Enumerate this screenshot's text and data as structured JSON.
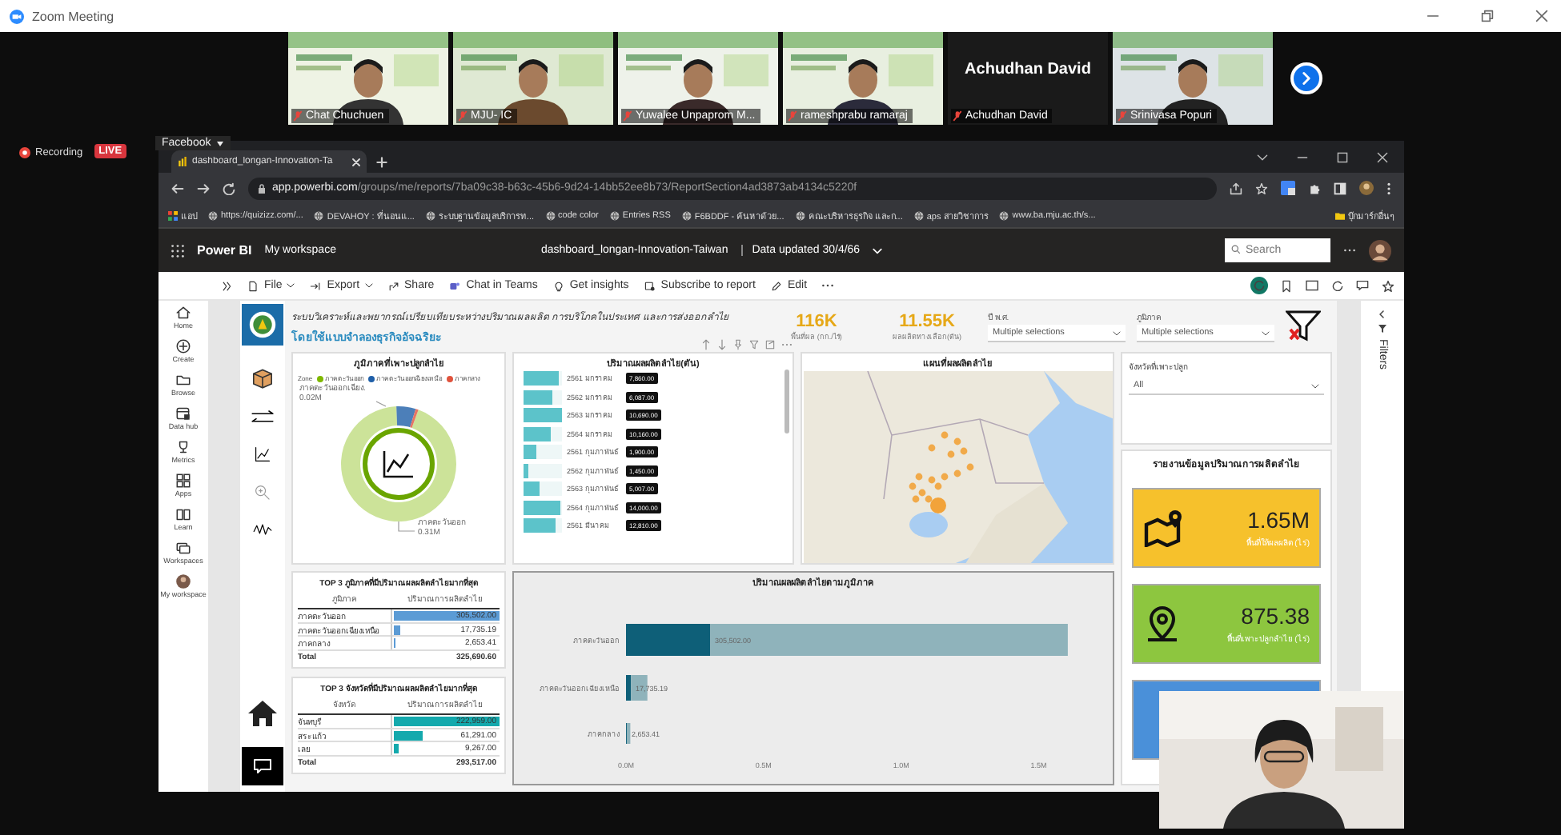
{
  "zoom_window": {
    "title": "Zoom Meeting"
  },
  "participants": [
    {
      "name": "Chat Chuchuen",
      "kind": "video",
      "muted": true
    },
    {
      "name": "MJU- IC",
      "kind": "video",
      "muted": true
    },
    {
      "name": "Yuwalee Unpaprom M...",
      "kind": "video",
      "muted": true
    },
    {
      "name": "rameshprabu ramaraj",
      "kind": "video",
      "muted": true
    },
    {
      "name": "Achudhan David",
      "kind": "name_only",
      "display_name": "Achudhan David",
      "muted": true
    },
    {
      "name": "Srinivasa Popuri",
      "kind": "video",
      "muted": true
    }
  ],
  "recording": {
    "label": "Recording",
    "live_badge": "LIVE"
  },
  "share_menu": {
    "label": "Facebook"
  },
  "browser": {
    "tab_title": "dashboard_longan-Innovation-Ta",
    "url_host": "app.powerbi.com",
    "url_path": "/groups/me/reports/7ba09c38-b63c-45b6-9d24-14bb52ee8b73/ReportSection4ad3873ab4134c5220f",
    "bookmarks": [
      {
        "label": "แอป"
      },
      {
        "label": "https://quizizz.com/..."
      },
      {
        "label": "DEVAHOY : ที่นอนแ..."
      },
      {
        "label": "ระบบฐานข้อมูลบริการท..."
      },
      {
        "label": "code color"
      },
      {
        "label": "Entries RSS"
      },
      {
        "label": "F6BDDF - ค้นหาด้วย..."
      },
      {
        "label": "คณะบริหารธุรกิจ และก..."
      },
      {
        "label": "aps สายวิชาการ"
      },
      {
        "label": "www.ba.mju.ac.th/s..."
      }
    ],
    "other_bookmarks": "บุ๊กมาร์กอื่นๆ"
  },
  "powerbi": {
    "app_name": "Power BI",
    "workspace": "My workspace",
    "report_name": "dashboard_longan-Innovation-Taiwan",
    "data_updated": "Data updated 30/4/66",
    "search_placeholder": "Search",
    "toolbar": [
      {
        "label": "File",
        "dropdown": true
      },
      {
        "label": "Export",
        "dropdown": true
      },
      {
        "label": "Share",
        "dropdown": false
      },
      {
        "label": "Chat in Teams",
        "dropdown": false
      },
      {
        "label": "Get insights",
        "dropdown": false
      },
      {
        "label": "Subscribe to report",
        "dropdown": false
      },
      {
        "label": "Edit",
        "dropdown": false
      }
    ],
    "nav": [
      {
        "label": "Home"
      },
      {
        "label": "Create"
      },
      {
        "label": "Browse"
      },
      {
        "label": "Data hub"
      },
      {
        "label": "Metrics"
      },
      {
        "label": "Apps"
      },
      {
        "label": "Learn"
      },
      {
        "label": "Workspaces"
      },
      {
        "label": "My workspace"
      }
    ]
  },
  "report": {
    "title_line1": "ระบบวิเคราะห์และพยากรณ์เปรียบเทียบระหว่างปริมาณผลผลิต การบริโภคในประเทศ และการส่งออกลำไย",
    "title_line2": "โดยใช้แบบจำลองธุรกิจอัจฉริยะ",
    "kpis": [
      {
        "value": "116K",
        "label": "พื้นที่ผล (กก./ไร่)"
      },
      {
        "value": "11.55K",
        "label": "ผลผลิตทางเลือก(ตัน)"
      }
    ],
    "slicers": [
      {
        "label": "ปี พ.ศ.",
        "value": "Multiple selections"
      },
      {
        "label": "ภูมิภาค",
        "value": "Multiple selections"
      }
    ],
    "donut": {
      "legend_title": "Zone",
      "chart_data": {
        "type": "donut",
        "title": "ภูมิภาคที่เพาะปลูกลำไย",
        "categories": [
          "ภาคตะวันออก",
          "ภาคตะวันออกเฉียงเหนือ",
          "ภาคกลาง"
        ],
        "values": [
          93.8,
          5.4,
          0.8
        ],
        "colors": [
          "#7fb800",
          "#1f5fa8",
          "#e0533d"
        ],
        "annotations": [
          {
            "text": "ภาคตะวันออกเฉียง."
          },
          {
            "text": "0.02M"
          },
          {
            "text": "ภาคตะวันออก"
          },
          {
            "text": "0.31M"
          }
        ]
      }
    },
    "bar_list": {
      "title": "ปริมาณผลผลิตลำไย(ตัน)",
      "rows": [
        {
          "label": "2561 มกราคม",
          "value": "7,860.00",
          "level": 0.9
        },
        {
          "label": "2562 มกราคม",
          "value": "6,087.00",
          "level": 0.75
        },
        {
          "label": "2563 มกราคม",
          "value": "10,690.00",
          "level": 1.0
        },
        {
          "label": "2564 มกราคม",
          "value": "10,160.00",
          "level": 0.7
        },
        {
          "label": "2561 กุมภาพันธ์",
          "value": "1,900.00",
          "level": 0.35
        },
        {
          "label": "2562 กุมภาพันธ์",
          "value": "1,450.00",
          "level": 0.12
        },
        {
          "label": "2563 กุมภาพันธ์",
          "value": "5,007.00",
          "level": 0.4
        },
        {
          "label": "2564 กุมภาพันธ์",
          "value": "14,000.00",
          "level": 0.95
        },
        {
          "label": "2561 มีนาคม",
          "value": "12,810.00",
          "level": 0.85
        }
      ]
    },
    "map": {
      "title": "แผนที่ผลผลิตลำไย",
      "kind": "picture"
    },
    "province_slicer": {
      "label": "จังหวัดที่เพาะปลูก",
      "value": "All"
    },
    "cards": {
      "title": "รายงานข้อมูลปริมาณการผลิตลำไย",
      "items": [
        {
          "value": "1.65M",
          "label": "พื้นที่ให้ผลผลิต (ไร่)",
          "color": "#f6c12c"
        },
        {
          "value": "875.38",
          "label": "พื้นที่เพาะปลูกลำไย (ไร่)",
          "color": "#8dc63f"
        },
        {
          "color": "#4a90d9"
        }
      ]
    },
    "tables": [
      {
        "title": "TOP 3 ภูมิภาคที่มีปริมาณผลผลิตลำไยมากที่สุด",
        "columns": [
          "ภูมิภาค",
          "ปริมาณการผลิตลำไย"
        ],
        "rows": [
          {
            "cells": [
              "ภาคตะวันออก",
              "305,502.00"
            ],
            "level": 1.0
          },
          {
            "cells": [
              "ภาคตะวันออกเฉียงเหนือ",
              "17,735.19"
            ],
            "level": 0.06
          },
          {
            "cells": [
              "ภาคกลาง",
              "2,653.41"
            ],
            "level": 0.01
          }
        ],
        "total": [
          "Total",
          "325,690.60"
        ]
      },
      {
        "title": "TOP 3 จังหวัดที่มีปริมาณผลผลิตลำไยมากที่สุด",
        "columns": [
          "จังหวัด",
          "ปริมาณการผลิตลำไย"
        ],
        "rows": [
          {
            "cells": [
              "จันทบุรี",
              "222,959.00"
            ],
            "level": 1.0
          },
          {
            "cells": [
              "สระแก้ว",
              "61,291.00"
            ],
            "level": 0.27
          },
          {
            "cells": [
              "เลย",
              "9,267.00"
            ],
            "level": 0.04
          }
        ],
        "total": [
          "Total",
          "293,517.00"
        ]
      }
    ],
    "bar_chart": {
      "chart_data": {
        "type": "bar",
        "orientation": "horizontal",
        "stacked": true,
        "title": "ปริมาณผลผลิตลำไยตามภูมิภาค",
        "categories": [
          "ภาคตะวันออก",
          "ภาคตะวันออกเฉียงเหนือ",
          "ภาคกลาง"
        ],
        "series": [
          {
            "color": "#0e5f78",
            "values": [
              305500,
              17700,
              2650
            ]
          },
          {
            "color": "#8fb3bb",
            "values": [
              1300000,
              60000,
              13000
            ]
          }
        ],
        "xlim": [
          0,
          1600000
        ],
        "xticks": [
          {
            "value": 0,
            "label": "0.0M"
          },
          {
            "value": 500000,
            "label": "0.5M"
          },
          {
            "value": 1000000,
            "label": "1.0M"
          },
          {
            "value": 1500000,
            "label": "1.5M"
          }
        ],
        "value_labels": [
          "305,502.00",
          "17,735.19",
          "2,653.41"
        ]
      }
    }
  },
  "filters_pane": {
    "label": "Filters"
  }
}
